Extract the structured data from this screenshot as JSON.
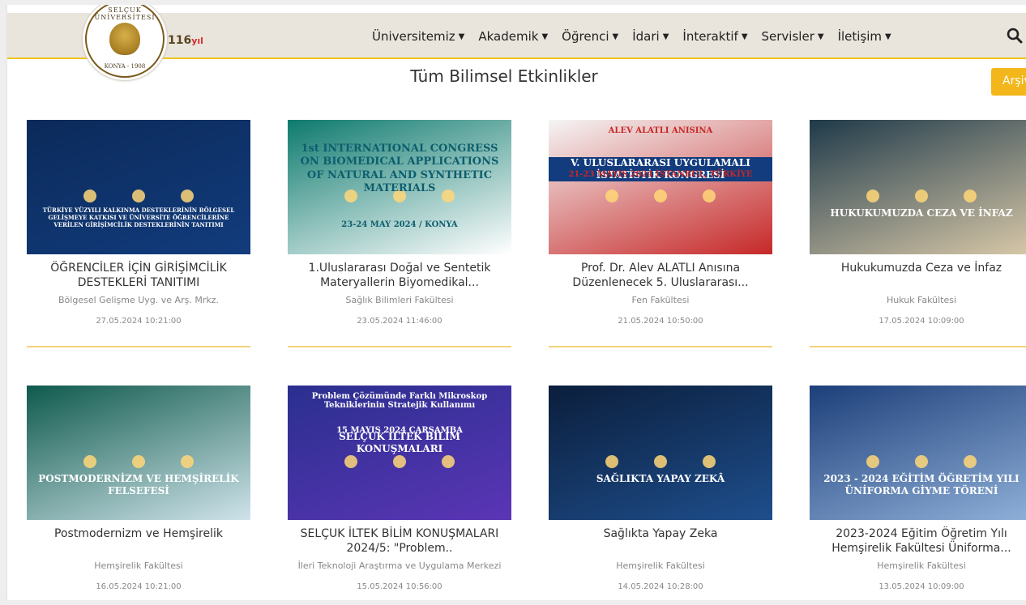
{
  "header": {
    "badge": "116",
    "badge_suffix": "yıl",
    "seal_top": "SELÇUK ÜNİVERSİTESİ",
    "seal_bottom": "KONYA - 1908"
  },
  "nav": [
    {
      "label": "Üniversitemiz",
      "icon": "caret-down"
    },
    {
      "label": "Akademik",
      "icon": "caret-down"
    },
    {
      "label": "Öğrenci",
      "icon": "caret-down"
    },
    {
      "label": "İdari",
      "icon": "caret-down"
    },
    {
      "label": "İnteraktif",
      "icon": "caret-down"
    },
    {
      "label": "Servisler",
      "icon": "caret-down"
    },
    {
      "label": "İletişim",
      "icon": "caret-down"
    }
  ],
  "search_icon": "search-icon",
  "page_title": "Tüm Bilimsel Etkinlikler",
  "archive_label": "Arşiv",
  "events": [
    {
      "title": "ÖĞRENCİLER İÇİN GİRİŞİMCİLİK DESTEKLERİ TANITIMI",
      "dept": "Bölgesel Gelişme Uyg. ve Arş. Mrkz.",
      "date": "27.05.2024 10:21:00",
      "banner": "TÜRKİYE YÜZYILI KALKINMA DESTEKLERİNİN BÖLGESEL GELİŞMEYE KATKISI VE ÜNİVERSİTE ÖĞRENCİLERİNE VERİLEN GİRİŞİMCİLİK DESTEKLERİNİN TANITIMI",
      "colors": [
        "#0b2a5a",
        "#123c7d"
      ]
    },
    {
      "title": "1.Uluslararası Doğal ve Sentetik Materyallerin Biyomedikal...",
      "dept": "Sağlık Bilimleri Fakültesi",
      "date": "23.05.2024 11:46:00",
      "banner": "1st INTERNATIONAL CONGRESS ON BIOMEDICAL APPLICATIONS OF NATURAL AND SYNTHETIC MATERIALS",
      "sub": "23-24 MAY 2024 / KONYA",
      "colors": [
        "#0e7a6e",
        "#ffffff"
      ]
    },
    {
      "title": "Prof. Dr. Alev ALATLI Anısına Düzenlenecek 5. Uluslararası...",
      "dept": "Fen Fakültesi",
      "date": "21.05.2024 10:50:00",
      "banner": "V. ULUSLARARASI UYGULAMALI İSTATİSTİK KONGRESİ",
      "sub": "21-23 MAYIS 2024 İSTANBUL, TÜRKİYE",
      "top": "ALEV ALATLI ANISINA",
      "colors": [
        "#f5f5f5",
        "#c62828"
      ]
    },
    {
      "title": "Hukukumuzda Ceza ve İnfaz",
      "dept": "Hukuk Fakültesi",
      "date": "17.05.2024 10:09:00",
      "banner": "HUKUKUMUZDA CEZA VE İNFAZ",
      "colors": [
        "#1f3a4a",
        "#d8c8a8"
      ]
    },
    {
      "title": "Postmodernizm ve Hemşirelik",
      "dept": "Hemşirelik Fakültesi",
      "date": "16.05.2024 10:21:00",
      "banner": "POSTMODERNİZM VE HEMŞİRELİK FELSEFESİ",
      "colors": [
        "#0f5a4c",
        "#cfe3ea"
      ]
    },
    {
      "title": "SELÇUK İLTEK BİLİM KONUŞMALARI 2024/5: \"Problem..",
      "dept": "İleri Teknoloji Araştırma ve Uygulama Merkezi",
      "date": "15.05.2024 10:56:00",
      "banner": "SELÇUK İLTEK BİLİM KONUŞMALARI",
      "top": "Problem Çözümünde Farklı Mikroskop Tekniklerinin Stratejik Kullanımı",
      "sub": "15 MAYIS 2024 ÇARŞAMBA",
      "colors": [
        "#2a2f8f",
        "#5b35b5"
      ]
    },
    {
      "title": "Sağlıkta Yapay Zeka",
      "dept": "Hemşirelik Fakültesi",
      "date": "14.05.2024 10:28:00",
      "banner": "SAĞLIKTA YAPAY ZEKÂ",
      "colors": [
        "#0b1e3c",
        "#1e4e8c"
      ]
    },
    {
      "title": "2023-2024 Eğitim Öğretim Yılı Hemşirelik Fakültesi Üniforma...",
      "dept": "Hemşirelik Fakültesi",
      "date": "13.05.2024 10:09:00",
      "banner": "2023 - 2024 EĞİTİM ÖĞRETİM YILI ÜNİFORMA GİYME TÖRENİ",
      "colors": [
        "#1d3f7a",
        "#8fb0d8"
      ]
    }
  ]
}
